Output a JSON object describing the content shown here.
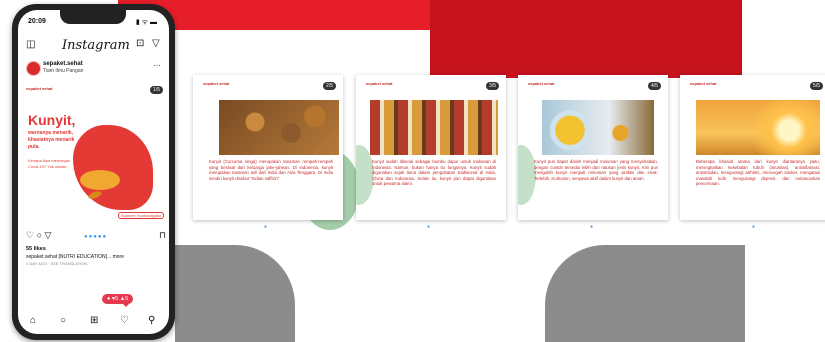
{
  "phone": {
    "time": "20:09",
    "status_icons": "▮ ᯤ ▬",
    "app_title": "Instagram",
    "username": "sepaket.sehat",
    "user_subtitle": "Tiam Ilmu Pangan",
    "slide_logo": "sepaket sehat",
    "slide_counter": "1/5",
    "headline": "Kunyit,",
    "headline_sub": "warnanya menarik, khasiatnya menarik pula.",
    "headline_sub2": "Kenapa bisa mencegah Covid-19? Yuk simak!",
    "source_tag": "Sumber: foodnavigator",
    "likes": "55 likes",
    "caption": "sepaket.sehat [NUTRI EDUCATION]... more",
    "caption_sub": "1 DAY AGO · SEE TRANSLATION",
    "notif": "● ♥5 ▲5"
  },
  "slides": [
    {
      "logo": "sepaket sehat",
      "counter": "2/5",
      "text": "Kunyit (Curcuma longa) merupakan tanaman rempah-rempah yang berasal dari keluarga jahe-jahean. Di Indonesia, kunyit merupakan tanaman asli dari India dan Asia Tenggara. Di India sendiri kunyit disebut \"Indian saffron\"."
    },
    {
      "logo": "sepaket sehat",
      "counter": "3/5",
      "text": "Kunyit sudah dikenal sebagai bumbu dapur untuk makanan di Indonesia. Namun, bukan hanya itu fungsinya. Kunyit sudah digunakan sejak lama dalam pengobatan tradisional di India, China dan Indonesia. Selain itu, kunyit pun dapat digunakan untuk pewarna alami."
    },
    {
      "logo": "sepaket sehat",
      "counter": "4/5",
      "text": "Kunyit pun dapat diolah menjadi minuman yang menyehatkan, dengan contoh tersedia lebih dari ratusan jenis kunyit. Kini pun mengolah kunyit menjadi minuman yang praktis dan enak. Terlebih, Kurkumin, senyawa aktif dalam kunyit dan aman."
    },
    {
      "logo": "sepaket sehat",
      "counter": "5/5",
      "text": "Beberapa khasiat utama dari kunyit diantaranya yaitu, meningkatkan kekebalan tubuh (imunitas), antiinflamasi, antioksidan, mengurangi arthritis, mencegah kanker, mengatasi masalah kulit, mengurangi depresi, dan melancarkan pencernaan."
    }
  ],
  "colors": {
    "accent_red": "#c62828",
    "bg_red": "#e61e2a",
    "gray": "#8c8c8c",
    "leaf_green": "#5aa564"
  }
}
